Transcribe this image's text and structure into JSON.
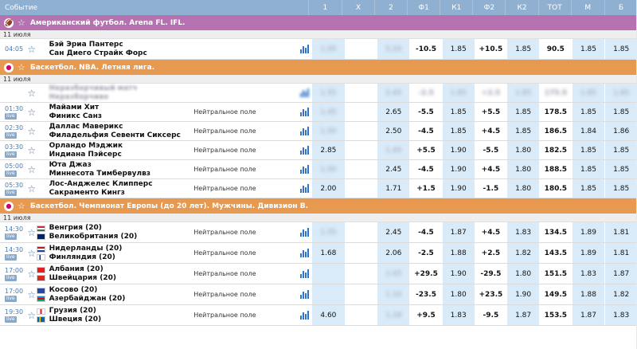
{
  "header": {
    "event_col": "Событие",
    "cols": [
      "1",
      "X",
      "2",
      "Ф1",
      "К1",
      "Ф2",
      "К2",
      "ТОТ",
      "М",
      "Б"
    ]
  },
  "sections": [
    {
      "category": "Американский футбол. Arena FL. IFL.",
      "color": "purple",
      "icon": "football-icon",
      "date": "11 июля",
      "events": [
        {
          "time": "04:05",
          "live": false,
          "team1": "Бэй Эриа Пантерс",
          "team2": "Сан Диего Страйк Форс",
          "note": "",
          "o1": "1.05",
          "ox": "",
          "o2": "5.20",
          "f1": "-10.5",
          "k1": "1.85",
          "f2": "+10.5",
          "k2": "1.85",
          "tot": "90.5",
          "m": "1.85",
          "b": "1.85",
          "blur": [
            "o1",
            "o2"
          ]
        }
      ]
    },
    {
      "category": "Баскетбол. NBA. Летняя лига.",
      "color": "orange",
      "icon": "basketball-icon",
      "date": "11 июля",
      "events": [
        {
          "time": "",
          "live": false,
          "team1": "Неразборчивый матч",
          "team2": "Неразборчиво",
          "note": "",
          "blurred_row": true,
          "o1": "1.55",
          "ox": "",
          "o2": "2.45",
          "f1": "-2.5",
          "k1": "1.85",
          "f2": "+2.5",
          "k2": "1.85",
          "tot": "175.5",
          "m": "1.85",
          "b": "1.85",
          "blur": [
            "o1",
            "ox",
            "o2",
            "f1",
            "k1",
            "f2",
            "k2",
            "tot",
            "m",
            "b"
          ]
        },
        {
          "time": "01:30",
          "live": true,
          "team1": "Майами Хит",
          "team2": "Финикс Санз",
          "note": "Нейтральное поле",
          "o1": "1.45",
          "ox": "",
          "o2": "2.65",
          "f1": "-5.5",
          "k1": "1.85",
          "f2": "+5.5",
          "k2": "1.85",
          "tot": "178.5",
          "m": "1.85",
          "b": "1.85",
          "blur": [
            "o1"
          ]
        },
        {
          "time": "02:30",
          "live": true,
          "team1": "Даллас Маверикс",
          "team2": "Филадельфия Севенти Сиксерс",
          "note": "Нейтральное поле",
          "o1": "1.50",
          "ox": "",
          "o2": "2.50",
          "f1": "-4.5",
          "k1": "1.85",
          "f2": "+4.5",
          "k2": "1.85",
          "tot": "186.5",
          "m": "1.84",
          "b": "1.86",
          "blur": [
            "o1"
          ]
        },
        {
          "time": "03:30",
          "live": true,
          "team1": "Орландо Мэджик",
          "team2": "Индиана Пэйсерс",
          "note": "Нейтральное поле",
          "o1": "2.85",
          "ox": "",
          "o2": "1.40",
          "f1": "+5.5",
          "k1": "1.90",
          "f2": "-5.5",
          "k2": "1.80",
          "tot": "182.5",
          "m": "1.85",
          "b": "1.85",
          "blur": [
            "o2"
          ]
        },
        {
          "time": "05:00",
          "live": true,
          "team1": "Юта Джаз",
          "team2": "Миннесота Тимбервулвз",
          "note": "Нейтральное поле",
          "o1": "1.50",
          "ox": "",
          "o2": "2.45",
          "f1": "-4.5",
          "k1": "1.90",
          "f2": "+4.5",
          "k2": "1.80",
          "tot": "188.5",
          "m": "1.85",
          "b": "1.85",
          "blur": [
            "o1"
          ]
        },
        {
          "time": "05:30",
          "live": true,
          "team1": "Лос-Анджелес Клипперс",
          "team2": "Сакраменто Кингз",
          "note": "Нейтральное поле",
          "o1": "2.00",
          "ox": "",
          "o2": "1.71",
          "f1": "+1.5",
          "k1": "1.90",
          "f2": "-1.5",
          "k2": "1.80",
          "tot": "180.5",
          "m": "1.85",
          "b": "1.85",
          "blur": []
        }
      ]
    },
    {
      "category": "Баскетбол. Чемпионат Европы (до 20 лет). Мужчины. Дивизион B.",
      "color": "orange",
      "icon": "basketball-icon",
      "date": "11 июля",
      "events": [
        {
          "time": "14:30",
          "live": true,
          "team1": "Венгрия (20)",
          "team2": "Великобритания (20)",
          "flag1": "hungary",
          "flag2": "uk",
          "note": "Нейтральное поле",
          "o1": "1.55",
          "ox": "",
          "o2": "2.45",
          "f1": "-4.5",
          "k1": "1.87",
          "f2": "+4.5",
          "k2": "1.83",
          "tot": "134.5",
          "m": "1.89",
          "b": "1.81",
          "blur": [
            "o1"
          ]
        },
        {
          "time": "14:30",
          "live": true,
          "team1": "Нидерланды (20)",
          "team2": "Финляндия (20)",
          "flag1": "netherlands",
          "flag2": "finland",
          "note": "Нейтральное поле",
          "o1": "1.68",
          "ox": "",
          "o2": "2.06",
          "f1": "-2.5",
          "k1": "1.88",
          "f2": "+2.5",
          "k2": "1.82",
          "tot": "143.5",
          "m": "1.89",
          "b": "1.81",
          "blur": []
        },
        {
          "time": "17:00",
          "live": true,
          "team1": "Албания (20)",
          "team2": "Швейцария (20)",
          "flag1": "albania",
          "flag2": "switzerland",
          "note": "Нейтральное поле",
          "o1": "",
          "ox": "",
          "o2": "1.05",
          "f1": "+29.5",
          "k1": "1.90",
          "f2": "-29.5",
          "k2": "1.80",
          "tot": "151.5",
          "m": "1.83",
          "b": "1.87",
          "blur": [
            "o2"
          ]
        },
        {
          "time": "17:00",
          "live": true,
          "team1": "Косово (20)",
          "team2": "Азербайджан (20)",
          "flag1": "kosovo",
          "flag2": "azerbaijan",
          "note": "Нейтральное поле",
          "o1": "",
          "ox": "",
          "o2": "1.10",
          "f1": "-23.5",
          "k1": "1.80",
          "f2": "+23.5",
          "k2": "1.90",
          "tot": "149.5",
          "m": "1.88",
          "b": "1.82",
          "blur": [
            "o2"
          ]
        },
        {
          "time": "19:30",
          "live": true,
          "team1": "Грузия (20)",
          "team2": "Швеция (20)",
          "flag1": "georgia",
          "flag2": "sweden",
          "note": "Нейтральное поле",
          "o1": "4.60",
          "ox": "",
          "o2": "1.18",
          "f1": "+9.5",
          "k1": "1.83",
          "f2": "-9.5",
          "k2": "1.87",
          "tot": "153.5",
          "m": "1.87",
          "b": "1.83",
          "blur": [
            "o2"
          ]
        }
      ]
    }
  ],
  "colors": {
    "header_bg": "#8fb0d0",
    "cat_purple": "#b571b0",
    "cat_orange": "#e79a4f",
    "odds_blue": "#d9ebf8",
    "accent": "#2f74c7"
  }
}
